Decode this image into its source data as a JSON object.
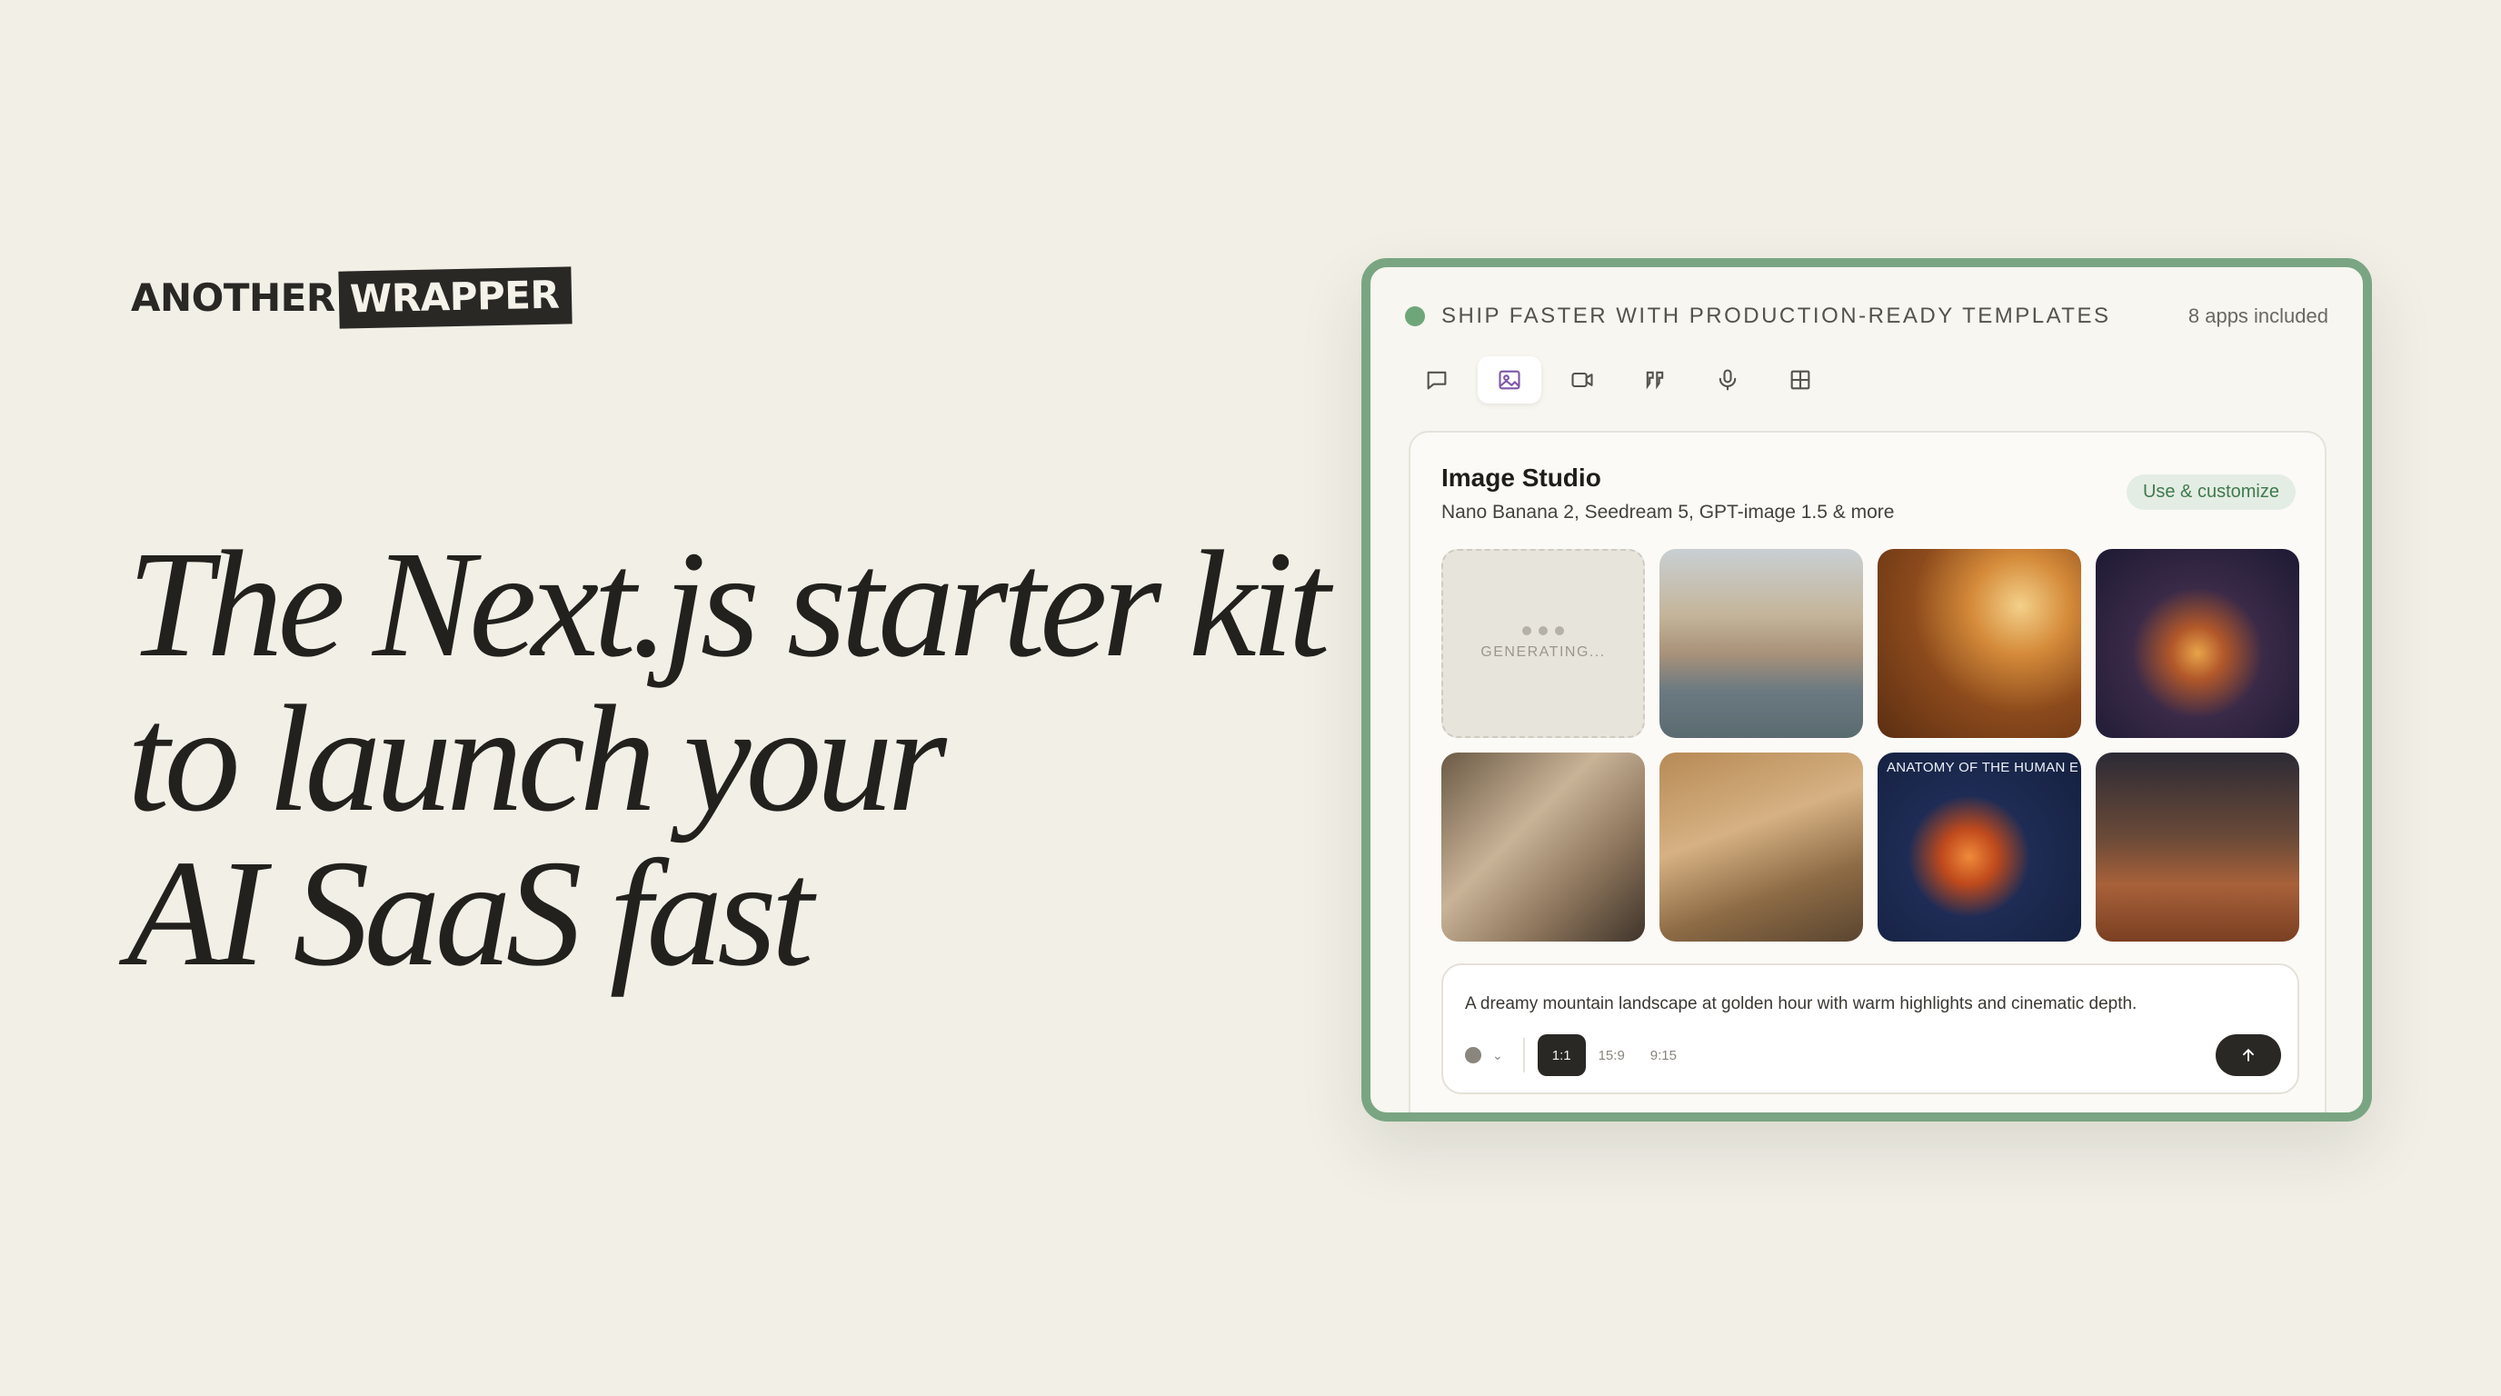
{
  "logo": {
    "part1": "ANOTHER",
    "part2": "WRAPPER"
  },
  "headline": {
    "line1": "The Next.js starter kit",
    "line2": "to launch your",
    "line3": "AI SaaS fast"
  },
  "card": {
    "status_text": "SHIP FASTER WITH PRODUCTION-READY TEMPLATES",
    "apps_count": "8 apps included",
    "accent_color": "#7aa582",
    "tabs": [
      {
        "icon": "chat-icon",
        "active": false
      },
      {
        "icon": "image-icon",
        "active": true
      },
      {
        "icon": "video-icon",
        "active": false
      },
      {
        "icon": "quote-icon",
        "active": false
      },
      {
        "icon": "microphone-icon",
        "active": false
      },
      {
        "icon": "grid-icon",
        "active": false
      }
    ],
    "panel": {
      "title": "Image Studio",
      "subtitle": "Nano Banana 2, Seedream 5, GPT-image 1.5 & more",
      "use_button": "Use & customize",
      "generating_label": "GENERATING...",
      "eye_label": "ANATOMY OF THE HUMAN EYE",
      "prompt_text": "A dreamy mountain landscape at golden hour with warm highlights and cinematic depth.",
      "ratios": [
        "1:1",
        "15:9",
        "9:15"
      ],
      "selected_ratio": "1:1"
    }
  }
}
